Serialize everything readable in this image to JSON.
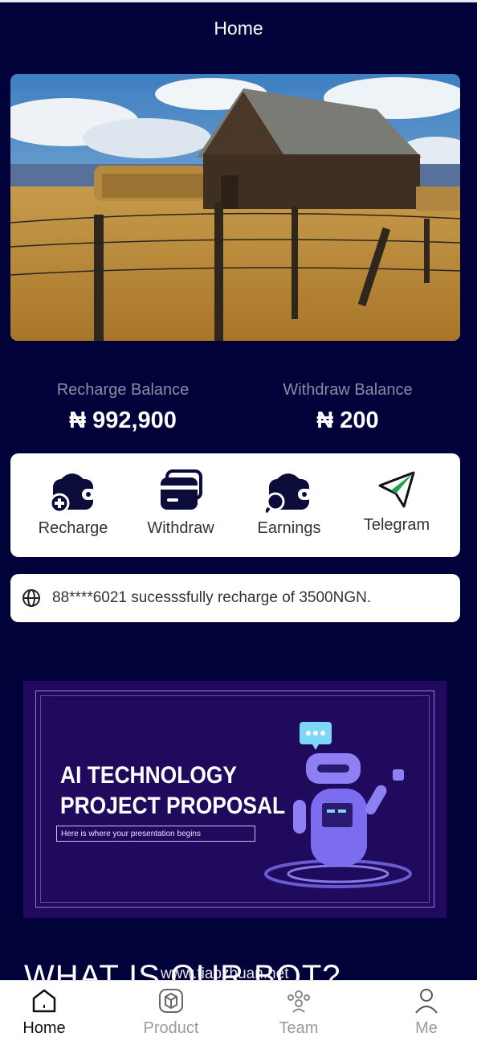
{
  "header": {
    "title": "Home"
  },
  "balances": {
    "recharge": {
      "label": "Recharge Balance",
      "value": "₦ 992,900"
    },
    "withdraw": {
      "label": "Withdraw Balance",
      "value": "₦ 200"
    }
  },
  "actions": [
    {
      "label": "Recharge",
      "icon": "wallet-plus-icon"
    },
    {
      "label": "Withdraw",
      "icon": "card-icon"
    },
    {
      "label": "Earnings",
      "icon": "wallet-search-icon"
    },
    {
      "label": "Telegram",
      "icon": "telegram-icon"
    }
  ],
  "notice": {
    "text": "88****6021 sucesssfully recharge of 3500NGN.",
    "icon": "globe-icon"
  },
  "banner": {
    "title_line1": "AI TECHNOLOGY",
    "title_line2": "PROJECT PROPOSAL",
    "subtitle": "Here is where your presentation begins"
  },
  "section": {
    "heading": "WHAT IS OUR BOT?"
  },
  "watermark": "www.tiaozhuan.net",
  "tabs": [
    {
      "label": "Home",
      "icon": "home-icon",
      "active": true
    },
    {
      "label": "Product",
      "icon": "box-icon",
      "active": false
    },
    {
      "label": "Team",
      "icon": "team-icon",
      "active": false
    },
    {
      "label": "Me",
      "icon": "user-icon",
      "active": false
    }
  ],
  "colors": {
    "background": "#02023a",
    "card": "#ffffff",
    "icon_dark": "#0c0c3a",
    "banner_bg": "#1f0a5e",
    "robot": "#7b6cf0"
  }
}
